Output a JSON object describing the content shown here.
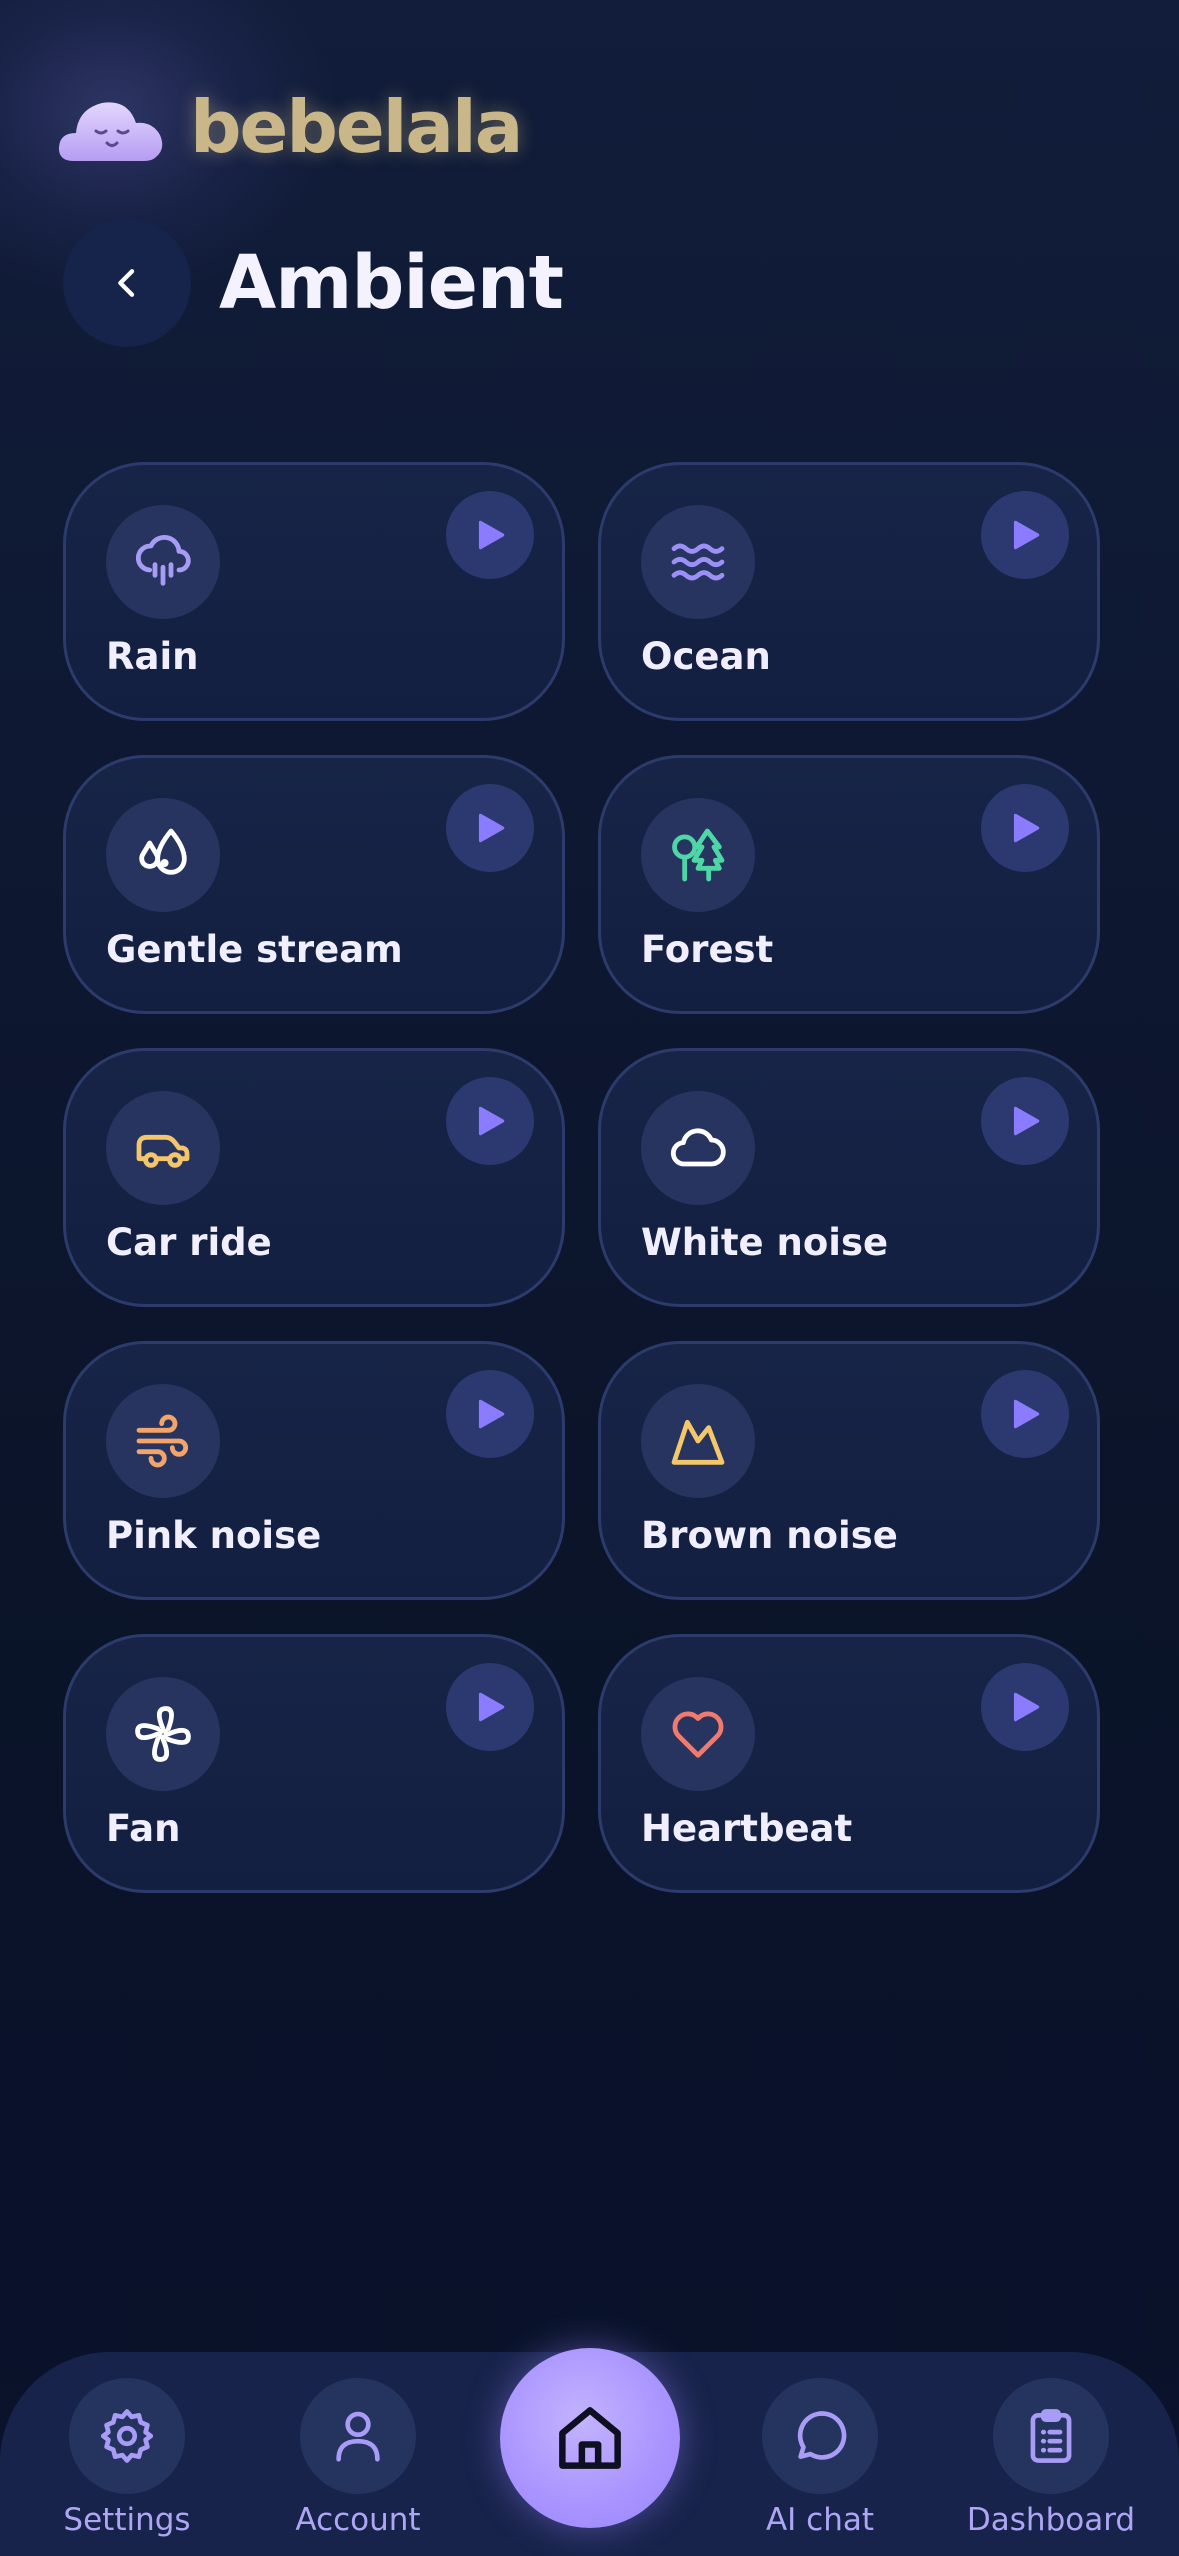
{
  "brand": {
    "name": "bebelala",
    "logo_icon": "sleepy-cloud-icon"
  },
  "header": {
    "title": "Ambient",
    "back_icon": "chevron-left-icon"
  },
  "colors": {
    "accent": "#8b7cff",
    "background": "#0d1733",
    "card": "#152244",
    "brand_text": "#c9b78a"
  },
  "sounds": [
    {
      "label": "Rain",
      "icon": "rain-cloud-icon",
      "icon_color": "#a79cf4"
    },
    {
      "label": "Ocean",
      "icon": "waves-icon",
      "icon_color": "#9c8ff6"
    },
    {
      "label": "Gentle stream",
      "icon": "droplets-icon",
      "icon_color": "#ffffff"
    },
    {
      "label": "Forest",
      "icon": "trees-icon",
      "icon_color": "#4fd6a6"
    },
    {
      "label": "Car ride",
      "icon": "car-icon",
      "icon_color": "#f4c56a"
    },
    {
      "label": "White noise",
      "icon": "cloud-icon",
      "icon_color": "#ffffff"
    },
    {
      "label": "Pink noise",
      "icon": "wind-icon",
      "icon_color": "#f2a46a"
    },
    {
      "label": "Brown noise",
      "icon": "mountain-icon",
      "icon_color": "#f2c86a"
    },
    {
      "label": "Fan",
      "icon": "fan-icon",
      "icon_color": "#ffffff"
    },
    {
      "label": "Heartbeat",
      "icon": "heart-icon",
      "icon_color": "#f07a6e"
    }
  ],
  "nav": {
    "settings": "Settings",
    "account": "Account",
    "home_icon": "home-icon",
    "ai_chat": "AI chat",
    "dashboard": "Dashboard"
  }
}
